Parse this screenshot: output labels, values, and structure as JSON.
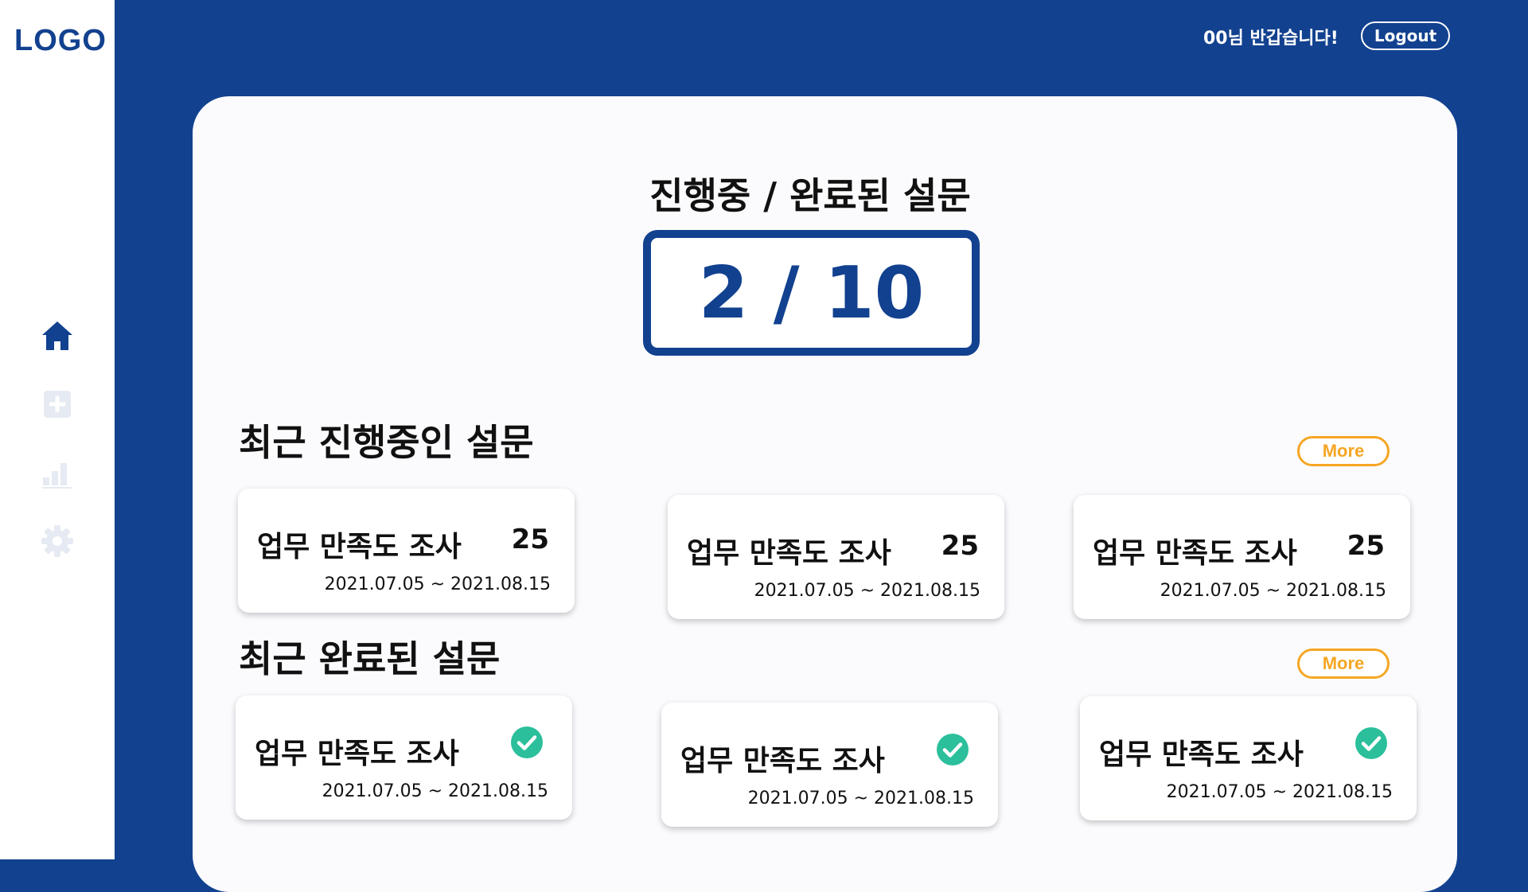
{
  "brand": {
    "logo": "LOGO"
  },
  "header": {
    "greeting": "00님 반갑습니다!",
    "logout_label": "Logout"
  },
  "sidebar": {
    "items": [
      {
        "name": "home",
        "icon": "home-icon",
        "active": true
      },
      {
        "name": "create",
        "icon": "plus-square-icon",
        "active": false
      },
      {
        "name": "stats",
        "icon": "bar-chart-icon",
        "active": false
      },
      {
        "name": "settings",
        "icon": "gear-icon",
        "active": false
      }
    ]
  },
  "summary": {
    "title": "진행중 / 완료된 설문",
    "value": "2 / 10"
  },
  "ongoing": {
    "title": "최근 진행중인 설문",
    "more_label": "More",
    "cards": [
      {
        "title": "업무 만족도 조사",
        "count": "25",
        "date": "2021.07.05 ~ 2021.08.15"
      },
      {
        "title": "업무 만족도 조사",
        "count": "25",
        "date": "2021.07.05 ~ 2021.08.15"
      },
      {
        "title": "업무 만족도 조사",
        "count": "25",
        "date": "2021.07.05 ~ 2021.08.15"
      }
    ]
  },
  "completed": {
    "title": "최근 완료된 설문",
    "more_label": "More",
    "cards": [
      {
        "title": "업무 만족도 조사",
        "status_icon": "check-circle-icon",
        "date": "2021.07.05 ~ 2021.08.15"
      },
      {
        "title": "업무 만족도 조사",
        "status_icon": "check-circle-icon",
        "date": "2021.07.05 ~ 2021.08.15"
      },
      {
        "title": "업무 만족도 조사",
        "status_icon": "check-circle-icon",
        "date": "2021.07.05 ~ 2021.08.15"
      }
    ]
  },
  "colors": {
    "primary": "#12418f",
    "accent": "#f5a623",
    "success": "#2bbf9b",
    "muted_icon": "#e6eaf2"
  }
}
